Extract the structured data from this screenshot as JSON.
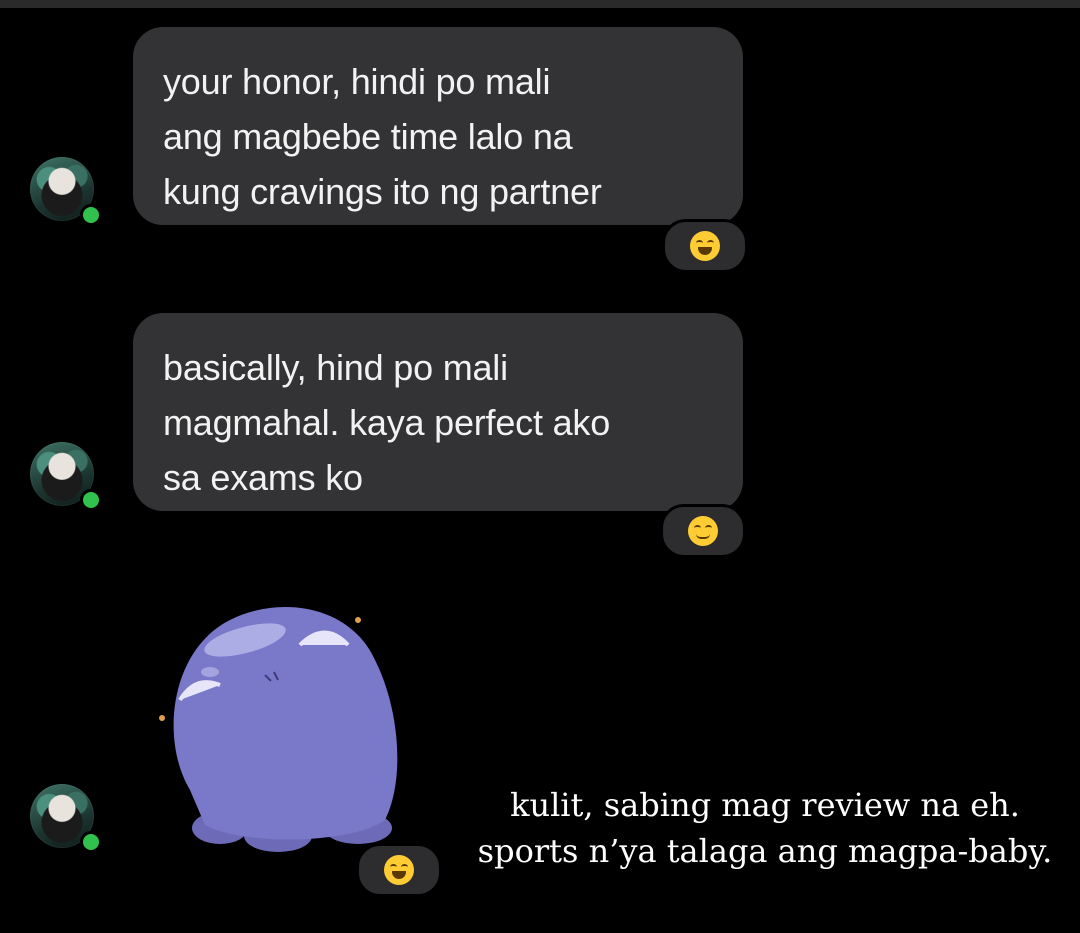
{
  "messages": [
    {
      "lines": [
        "your honor, hindi po mali",
        "ang magbebe time lalo na",
        "kung cravings ito ng partner"
      ],
      "reaction": "laughing-emoji"
    },
    {
      "lines": [
        "basically, hind po mali",
        "magmahal. kaya perfect ako",
        "sa exams ko"
      ],
      "reaction": "relieved-emoji"
    },
    {
      "sticker": "purple-blob-sticker",
      "reaction": "laughing-emoji"
    }
  ],
  "caption": {
    "lines": [
      "kulit, sabing mag review na eh.",
      "sports n’ya talaga ang magpa-baby."
    ]
  },
  "colors": {
    "background": "#000000",
    "bubble": "#333335",
    "online_status": "#31c24d",
    "sticker_purple": "#7a78c8"
  }
}
